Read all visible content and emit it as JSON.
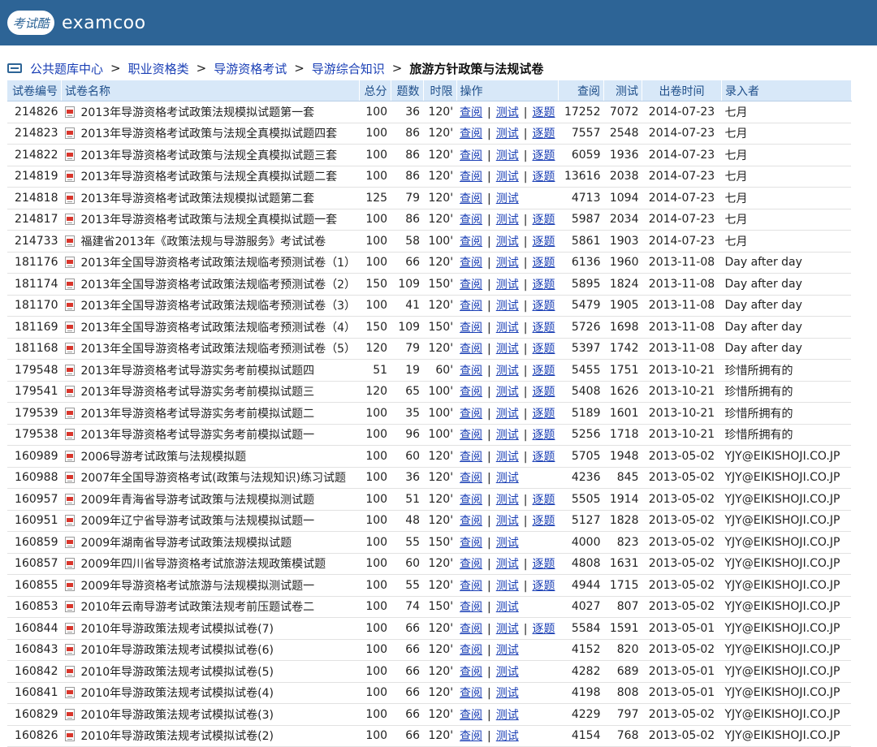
{
  "header": {
    "logo_text": "考试酷",
    "site_name": "examcoo"
  },
  "breadcrumb": {
    "items": [
      "公共题库中心",
      "职业资格类",
      "导游资格考试",
      "导游综合知识"
    ],
    "current": "旅游方针政策与法规试卷"
  },
  "columns": {
    "id": "试卷编号",
    "name": "试卷名称",
    "score": "总分",
    "questions": "题数",
    "time": "时限",
    "ops": "操作",
    "views": "查阅",
    "tests": "测试",
    "date": "出卷时间",
    "author": "录入者"
  },
  "op_labels": {
    "view": "查阅",
    "test": "测试",
    "questions": "逐题"
  },
  "rows": [
    {
      "id": "214826",
      "name": "2013年导游资格考试政策法规模拟试题第一套",
      "score": "100",
      "questions": "36",
      "time": "120'",
      "ops": [
        "查阅",
        "测试",
        "逐题"
      ],
      "views": "17252",
      "tests": "7072",
      "date": "2014-07-23",
      "author": "七月"
    },
    {
      "id": "214823",
      "name": "2013年导游资格考试政策与法规全真模拟试题四套",
      "score": "100",
      "questions": "86",
      "time": "120'",
      "ops": [
        "查阅",
        "测试",
        "逐题"
      ],
      "views": "7557",
      "tests": "2548",
      "date": "2014-07-23",
      "author": "七月"
    },
    {
      "id": "214822",
      "name": "2013年导游资格考试政策与法规全真模拟试题三套",
      "score": "100",
      "questions": "86",
      "time": "120'",
      "ops": [
        "查阅",
        "测试",
        "逐题"
      ],
      "views": "6059",
      "tests": "1936",
      "date": "2014-07-23",
      "author": "七月"
    },
    {
      "id": "214819",
      "name": "2013年导游资格考试政策与法规全真模拟试题二套",
      "score": "100",
      "questions": "86",
      "time": "120'",
      "ops": [
        "查阅",
        "测试",
        "逐题"
      ],
      "views": "13616",
      "tests": "2038",
      "date": "2014-07-23",
      "author": "七月"
    },
    {
      "id": "214818",
      "name": "2013年导游资格考试政策法规模拟试题第二套",
      "score": "125",
      "questions": "79",
      "time": "120'",
      "ops": [
        "查阅",
        "测试"
      ],
      "views": "4713",
      "tests": "1094",
      "date": "2014-07-23",
      "author": "七月"
    },
    {
      "id": "214817",
      "name": "2013年导游资格考试政策与法规全真模拟试题一套",
      "score": "100",
      "questions": "86",
      "time": "120'",
      "ops": [
        "查阅",
        "测试",
        "逐题"
      ],
      "views": "5987",
      "tests": "2034",
      "date": "2014-07-23",
      "author": "七月"
    },
    {
      "id": "214733",
      "name": "福建省2013年《政策法规与导游服务》考试试卷",
      "score": "100",
      "questions": "58",
      "time": "100'",
      "ops": [
        "查阅",
        "测试",
        "逐题"
      ],
      "views": "5861",
      "tests": "1903",
      "date": "2014-07-23",
      "author": "七月"
    },
    {
      "id": "181176",
      "name": "2013年全国导游资格考试政策法规临考预测试卷（1）",
      "score": "100",
      "questions": "66",
      "time": "120'",
      "ops": [
        "查阅",
        "测试",
        "逐题"
      ],
      "views": "6136",
      "tests": "1960",
      "date": "2013-11-08",
      "author": "Day after day"
    },
    {
      "id": "181174",
      "name": "2013年全国导游资格考试政策法规临考预测试卷（2）",
      "score": "150",
      "questions": "109",
      "time": "150'",
      "ops": [
        "查阅",
        "测试",
        "逐题"
      ],
      "views": "5895",
      "tests": "1824",
      "date": "2013-11-08",
      "author": "Day after day"
    },
    {
      "id": "181170",
      "name": "2013年全国导游资格考试政策法规临考预测试卷（3）",
      "score": "100",
      "questions": "41",
      "time": "120'",
      "ops": [
        "查阅",
        "测试",
        "逐题"
      ],
      "views": "5479",
      "tests": "1905",
      "date": "2013-11-08",
      "author": "Day after day"
    },
    {
      "id": "181169",
      "name": "2013年全国导游资格考试政策法规临考预测试卷（4）",
      "score": "150",
      "questions": "109",
      "time": "150'",
      "ops": [
        "查阅",
        "测试",
        "逐题"
      ],
      "views": "5726",
      "tests": "1698",
      "date": "2013-11-08",
      "author": "Day after day"
    },
    {
      "id": "181168",
      "name": "2013年全国导游资格考试政策法规临考预测试卷（5）",
      "score": "120",
      "questions": "79",
      "time": "120'",
      "ops": [
        "查阅",
        "测试",
        "逐题"
      ],
      "views": "5397",
      "tests": "1742",
      "date": "2013-11-08",
      "author": "Day after day"
    },
    {
      "id": "179548",
      "name": "2013年导游资格考试导游实务考前模拟试题四",
      "score": "51",
      "questions": "19",
      "time": "60'",
      "ops": [
        "查阅",
        "测试",
        "逐题"
      ],
      "views": "5455",
      "tests": "1751",
      "date": "2013-10-21",
      "author": "珍惜所拥有的"
    },
    {
      "id": "179541",
      "name": "2013年导游资格考试导游实务考前模拟试题三",
      "score": "120",
      "questions": "65",
      "time": "100'",
      "ops": [
        "查阅",
        "测试",
        "逐题"
      ],
      "views": "5408",
      "tests": "1626",
      "date": "2013-10-21",
      "author": "珍惜所拥有的"
    },
    {
      "id": "179539",
      "name": "2013年导游资格考试导游实务考前模拟试题二",
      "score": "100",
      "questions": "35",
      "time": "100'",
      "ops": [
        "查阅",
        "测试",
        "逐题"
      ],
      "views": "5189",
      "tests": "1601",
      "date": "2013-10-21",
      "author": "珍惜所拥有的"
    },
    {
      "id": "179538",
      "name": "2013年导游资格考试导游实务考前模拟试题一",
      "score": "100",
      "questions": "96",
      "time": "100'",
      "ops": [
        "查阅",
        "测试",
        "逐题"
      ],
      "views": "5256",
      "tests": "1718",
      "date": "2013-10-21",
      "author": "珍惜所拥有的"
    },
    {
      "id": "160989",
      "name": "2006导游考试政策与法规模拟题",
      "score": "100",
      "questions": "60",
      "time": "120'",
      "ops": [
        "查阅",
        "测试",
        "逐题"
      ],
      "views": "5705",
      "tests": "1948",
      "date": "2013-05-02",
      "author": "YJY@EIKISHOJI.CO.JP"
    },
    {
      "id": "160988",
      "name": "2007年全国导游资格考试(政策与法规知识)练习试题",
      "score": "100",
      "questions": "36",
      "time": "120'",
      "ops": [
        "查阅",
        "测试"
      ],
      "views": "4236",
      "tests": "845",
      "date": "2013-05-02",
      "author": "YJY@EIKISHOJI.CO.JP"
    },
    {
      "id": "160957",
      "name": "2009年青海省导游考试政策与法规模拟测试题",
      "score": "100",
      "questions": "51",
      "time": "120'",
      "ops": [
        "查阅",
        "测试",
        "逐题"
      ],
      "views": "5505",
      "tests": "1914",
      "date": "2013-05-02",
      "author": "YJY@EIKISHOJI.CO.JP"
    },
    {
      "id": "160951",
      "name": "2009年辽宁省导游考试政策与法规模拟试题一",
      "score": "100",
      "questions": "48",
      "time": "120'",
      "ops": [
        "查阅",
        "测试",
        "逐题"
      ],
      "views": "5127",
      "tests": "1828",
      "date": "2013-05-02",
      "author": "YJY@EIKISHOJI.CO.JP"
    },
    {
      "id": "160859",
      "name": "2009年湖南省导游考试政策法规模拟试题",
      "score": "100",
      "questions": "55",
      "time": "150'",
      "ops": [
        "查阅",
        "测试"
      ],
      "views": "4000",
      "tests": "823",
      "date": "2013-05-02",
      "author": "YJY@EIKISHOJI.CO.JP"
    },
    {
      "id": "160857",
      "name": "2009年四川省导游资格考试旅游法规政策模试题",
      "score": "100",
      "questions": "60",
      "time": "120'",
      "ops": [
        "查阅",
        "测试",
        "逐题"
      ],
      "views": "4808",
      "tests": "1631",
      "date": "2013-05-02",
      "author": "YJY@EIKISHOJI.CO.JP"
    },
    {
      "id": "160855",
      "name": "2009年导游资格考试旅游与法规模拟测试题一",
      "score": "100",
      "questions": "55",
      "time": "120'",
      "ops": [
        "查阅",
        "测试",
        "逐题"
      ],
      "views": "4944",
      "tests": "1715",
      "date": "2013-05-02",
      "author": "YJY@EIKISHOJI.CO.JP"
    },
    {
      "id": "160853",
      "name": "2010年云南导游考试政策法规考前压题试卷二",
      "score": "100",
      "questions": "74",
      "time": "150'",
      "ops": [
        "查阅",
        "测试"
      ],
      "views": "4027",
      "tests": "807",
      "date": "2013-05-02",
      "author": "YJY@EIKISHOJI.CO.JP"
    },
    {
      "id": "160844",
      "name": "2010年导游政策法规考试模拟试卷(7)",
      "score": "100",
      "questions": "66",
      "time": "120'",
      "ops": [
        "查阅",
        "测试",
        "逐题"
      ],
      "views": "5584",
      "tests": "1591",
      "date": "2013-05-01",
      "author": "YJY@EIKISHOJI.CO.JP"
    },
    {
      "id": "160843",
      "name": "2010年导游政策法规考试模拟试卷(6)",
      "score": "100",
      "questions": "66",
      "time": "120'",
      "ops": [
        "查阅",
        "测试"
      ],
      "views": "4152",
      "tests": "820",
      "date": "2013-05-02",
      "author": "YJY@EIKISHOJI.CO.JP"
    },
    {
      "id": "160842",
      "name": "2010年导游政策法规考试模拟试卷(5)",
      "score": "100",
      "questions": "66",
      "time": "120'",
      "ops": [
        "查阅",
        "测试"
      ],
      "views": "4282",
      "tests": "689",
      "date": "2013-05-01",
      "author": "YJY@EIKISHOJI.CO.JP"
    },
    {
      "id": "160841",
      "name": "2010年导游政策法规考试模拟试卷(4)",
      "score": "100",
      "questions": "66",
      "time": "120'",
      "ops": [
        "查阅",
        "测试"
      ],
      "views": "4198",
      "tests": "808",
      "date": "2013-05-01",
      "author": "YJY@EIKISHOJI.CO.JP"
    },
    {
      "id": "160829",
      "name": "2010年导游政策法规考试模拟试卷(3)",
      "score": "100",
      "questions": "66",
      "time": "120'",
      "ops": [
        "查阅",
        "测试"
      ],
      "views": "4229",
      "tests": "797",
      "date": "2013-05-02",
      "author": "YJY@EIKISHOJI.CO.JP"
    },
    {
      "id": "160826",
      "name": "2010年导游政策法规考试模拟试卷(2)",
      "score": "100",
      "questions": "66",
      "time": "120'",
      "ops": [
        "查阅",
        "测试"
      ],
      "views": "4154",
      "tests": "768",
      "date": "2013-05-02",
      "author": "YJY@EIKISHOJI.CO.JP"
    }
  ]
}
